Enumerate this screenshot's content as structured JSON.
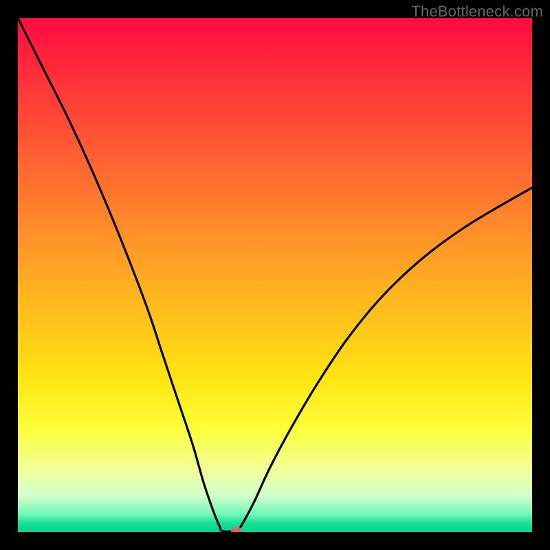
{
  "watermark": "TheBottleneck.com",
  "chart_data": {
    "type": "line",
    "title": "",
    "xlabel": "",
    "ylabel": "",
    "xlim": [
      0,
      100
    ],
    "ylim": [
      0,
      100
    ],
    "grid": false,
    "legend": false,
    "series": [
      {
        "name": "bottleneck-curve",
        "color": "#000000",
        "x": [
          0,
          5,
          10,
          15,
          20,
          25,
          28,
          31,
          34,
          36,
          37.5,
          38.5,
          39.2,
          39.8,
          42.5,
          43.0,
          44.0,
          46.0,
          49.0,
          53.0,
          58.0,
          64.0,
          71.0,
          79.0,
          88.0,
          100.0
        ],
        "y": [
          100,
          90,
          80,
          69,
          57,
          44,
          35,
          26,
          17,
          10,
          5.5,
          2.8,
          1.2,
          0.2,
          0.2,
          0.6,
          2.2,
          6.0,
          12.5,
          20.0,
          28.5,
          37.5,
          46.0,
          53.5,
          60.0,
          67.0
        ]
      }
    ],
    "marker": {
      "name": "optimal-point",
      "x": 42.5,
      "y": 0.3,
      "label": ""
    },
    "background_gradient": {
      "top": "#ff0b3f",
      "mid": "#ffe412",
      "bottom": "#05d28f"
    }
  }
}
